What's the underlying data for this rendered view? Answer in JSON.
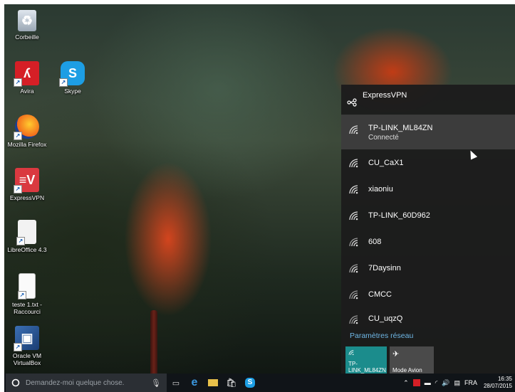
{
  "desktop": {
    "icons": [
      {
        "label": "Corbeille"
      },
      {
        "label": "Avira"
      },
      {
        "label": "Skype"
      },
      {
        "label": "Mozilla Firefox"
      },
      {
        "label": "ExpressVPN"
      },
      {
        "label": "LibreOffice 4.3"
      },
      {
        "label": "teste 1.txt -",
        "label2": "Raccourci"
      },
      {
        "label": "Oracle VM",
        "label2": "VirtualBox"
      }
    ]
  },
  "flyout": {
    "vpn_name": "ExpressVPN",
    "networks": [
      {
        "name": "TP-LINK_ML84ZN",
        "status": "Connecté"
      },
      {
        "name": "CU_CaX1"
      },
      {
        "name": "xiaoniu"
      },
      {
        "name": "TP-LINK_60D962"
      },
      {
        "name": "608"
      },
      {
        "name": "7Daysinn"
      },
      {
        "name": "CMCC"
      },
      {
        "name": "CU_uqzQ"
      }
    ],
    "settings_link": "Paramètres réseau",
    "quick_actions": [
      {
        "label": "TP-LINK_ML84ZN",
        "active": true
      },
      {
        "label": "Mode Avion",
        "active": false
      }
    ]
  },
  "taskbar": {
    "search_placeholder": "Demandez-moi quelque chose.",
    "language": "FRA",
    "time": "16:35",
    "date": "28/07/2015"
  },
  "colors": {
    "accent": "#1b8c8c",
    "link": "#6fb7e6",
    "flyout_bg": "#1c1c1c"
  }
}
